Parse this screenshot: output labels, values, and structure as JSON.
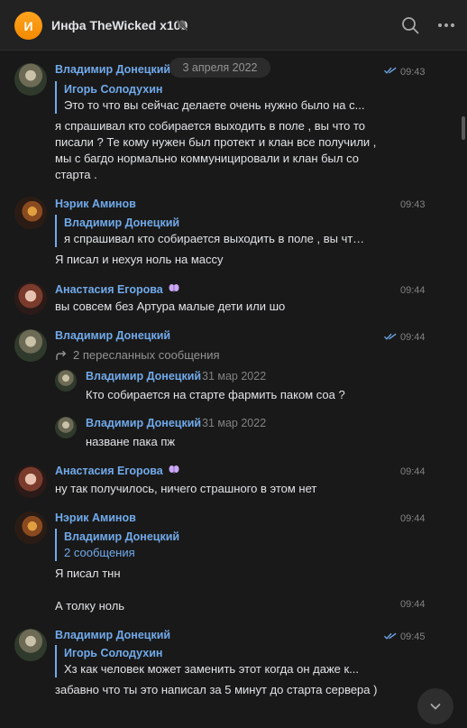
{
  "header": {
    "avatar_letter": "И",
    "title": "Инфа TheWicked x100",
    "mute_icon": "muted-bell-icon",
    "search_icon": "search-icon",
    "more_icon": "more-dots-icon"
  },
  "date_chip": "3 апреля 2022",
  "colors": {
    "accent": "#71aaeb",
    "background": "#191919",
    "header": "#222222",
    "text": "#e1e3e6",
    "secondary": "#828282"
  },
  "messages": [
    {
      "author": "Владимир Донецкий",
      "time": "09:43",
      "read": true,
      "reply_author": "Игорь Солодухин",
      "reply_text": "Это то что вы сейчас делаете очень нужно было на с...",
      "text": "я спрашивал кто собирается выходить в поле , вы что то писали ? Те кому нужен был протект и клан все получили , мы с багдо нормально коммуницировали и клан был со старта ."
    },
    {
      "author": "Нэрик Аминов",
      "time": "09:43",
      "reply_author": "Владимир Донецкий",
      "reply_text": "я спрашивал кто собирается выходить в поле , вы что т...",
      "text": "Я писал и нехуя ноль на массу"
    },
    {
      "author": "Анастасия Егорова",
      "time": "09:44",
      "text": "вы совсем без Артура малые дети или шо"
    },
    {
      "author": "Владимир Донецкий",
      "time": "09:44",
      "read": true,
      "forwarded_label": "2 пересланных сообщения",
      "forwarded": [
        {
          "author": "Владимир Донецкий",
          "date": "31 мар 2022",
          "text": "Кто собирается на старте фармить паком соа ?"
        },
        {
          "author": "Владимир Донецкий",
          "date": "31 мар 2022",
          "text": "назване пака пж"
        }
      ]
    },
    {
      "author": "Анастасия Егорова",
      "time": "09:44",
      "text": "ну так получилось, ничего страшного в этом нет"
    },
    {
      "author": "Нэрик Аминов",
      "time": "09:44",
      "reply_author": "Владимир Донецкий",
      "reply_text": "2 сообщения",
      "text": "Я писал тнн",
      "followup_text": "А толку ноль",
      "followup_time": "09:44"
    },
    {
      "author": "Владимир Донецкий",
      "time": "09:45",
      "read": true,
      "reply_author": "Игорь Солодухин",
      "reply_text": "Хз как человек может заменить этот когда он даже к...",
      "text": "забавно что ты это написал за 5 минут до старта сервера )"
    }
  ],
  "scroll_down_icon": "chevron-down-icon"
}
